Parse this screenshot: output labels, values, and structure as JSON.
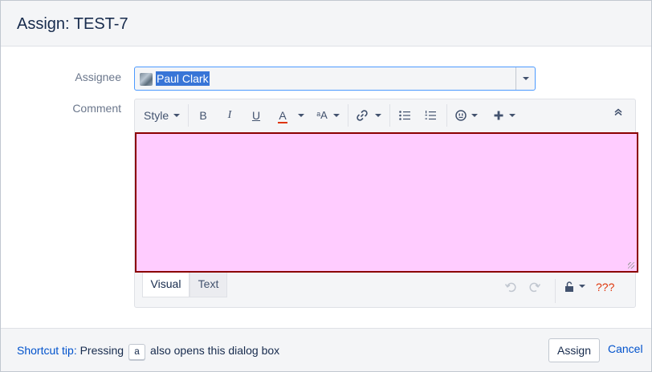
{
  "dialog": {
    "title": "Assign: TEST-7"
  },
  "form": {
    "assignee_label": "Assignee",
    "assignee_value": "Paul Clark",
    "comment_label": "Comment"
  },
  "toolbar": {
    "style_label": "Style",
    "bold_label": "B",
    "italic_label": "I",
    "underline_label": "U",
    "text_color_label": "A",
    "text_color_accent": "#de350b",
    "font_size_label": "ᵃA"
  },
  "editor": {
    "content_background": "#ffccff",
    "content_border": "#8b0000",
    "tabs": [
      "Visual",
      "Text"
    ],
    "active_tab": "Visual",
    "help_label": "???"
  },
  "footer": {
    "tip_link": "Shortcut tip:",
    "tip_text_before": "Pressing",
    "tip_key": "a",
    "tip_text_after": "also opens this dialog box",
    "assign_button": "Assign",
    "cancel_link": "Cancel"
  },
  "icons": {
    "collapse": "chevron-double-up-icon",
    "link": "link-icon",
    "bullet_list": "bullet-list-icon",
    "numbered_list": "numbered-list-icon",
    "emoji": "emoticon-icon",
    "insert": "plus-icon",
    "undo": "undo-icon",
    "redo": "redo-icon",
    "security": "unlock-icon"
  }
}
